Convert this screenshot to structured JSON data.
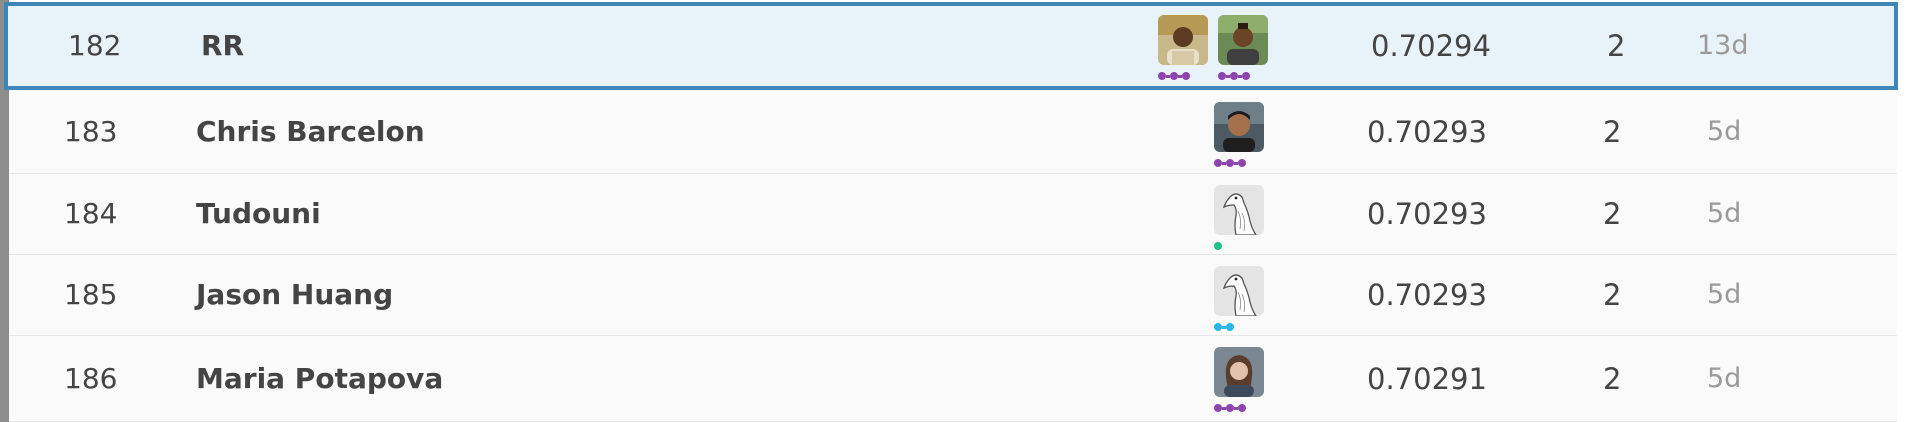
{
  "leaderboard": {
    "highlight": {
      "rank": "182",
      "team": "RR",
      "score": "0.70294",
      "entries": "2",
      "last": "13d",
      "members": [
        {
          "avatar": "user-photo-icon",
          "tier": "master"
        },
        {
          "avatar": "user-photo-icon",
          "tier": "master"
        }
      ]
    },
    "rows": [
      {
        "rank": "183",
        "team": "Chris Barcelon",
        "score": "0.70293",
        "entries": "2",
        "last": "5d",
        "members": [
          {
            "avatar": "user-photo-icon",
            "tier": "master"
          }
        ]
      },
      {
        "rank": "184",
        "team": "Tudouni",
        "score": "0.70293",
        "entries": "2",
        "last": "5d",
        "members": [
          {
            "avatar": "default-goose-avatar-icon",
            "tier": "contributor"
          }
        ]
      },
      {
        "rank": "185",
        "team": "Jason Huang",
        "score": "0.70293",
        "entries": "2",
        "last": "5d",
        "members": [
          {
            "avatar": "default-goose-avatar-icon",
            "tier": "expert"
          }
        ]
      },
      {
        "rank": "186",
        "team": "Maria Potapova",
        "score": "0.70291",
        "entries": "2",
        "last": "5d",
        "members": [
          {
            "avatar": "user-photo-icon",
            "tier": "master"
          }
        ]
      }
    ],
    "colors": {
      "highlight_border": "#3f86b8",
      "highlight_bg": "#e8f3f9",
      "tier_master": "#8e44ad",
      "tier_expert": "#29b6e8",
      "tier_contributor": "#20c08b"
    }
  }
}
